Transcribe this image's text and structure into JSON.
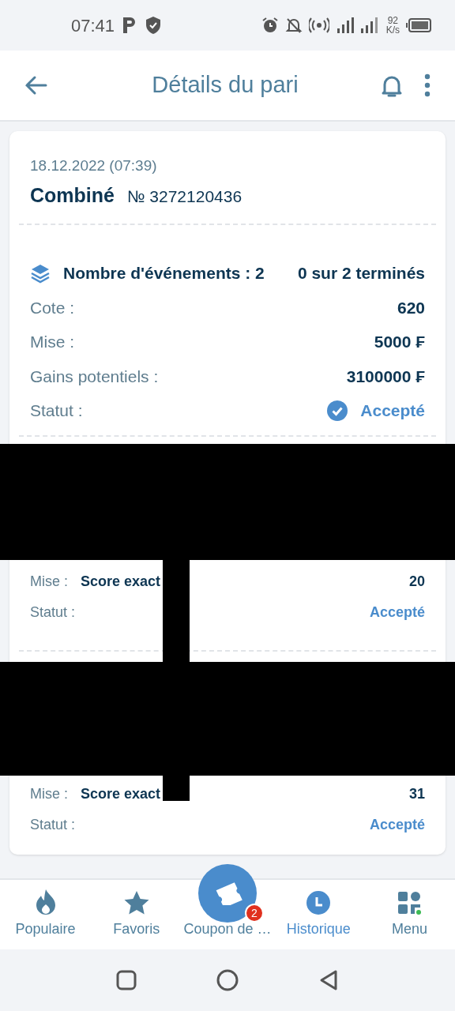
{
  "status_bar": {
    "time": "07:41",
    "net_speed": "92",
    "net_unit": "K/s"
  },
  "header": {
    "title": "Détails du pari"
  },
  "bet": {
    "date": "18.12.2022 (07:39)",
    "type": "Combiné",
    "number": "№ 3272120436"
  },
  "summary": {
    "events": "Nombre d'événements : 2",
    "finished": "0 sur 2 terminés",
    "rows": [
      {
        "kind": "plain",
        "label": "Cote :",
        "value": "620"
      },
      {
        "kind": "plain",
        "label": "Mise :",
        "value": "5000 ₣"
      },
      {
        "kind": "plain",
        "label": "Gains potentiels :",
        "value": "3100000 ₣"
      },
      {
        "kind": "status",
        "label": "Statut :",
        "value": "Accepté"
      }
    ]
  },
  "events": [
    {
      "label": "Mise :",
      "market": "Score exact",
      "odds": "20",
      "status_label": "Statut :",
      "status": "Accepté"
    },
    {
      "label": "Mise :",
      "market": "Score exact",
      "odds": "31",
      "status_label": "Statut :",
      "status": "Accepté"
    }
  ],
  "bottom_nav": [
    {
      "label": "Populaire",
      "kind": "flame",
      "selected": false
    },
    {
      "label": "Favoris",
      "kind": "star",
      "selected": false
    },
    {
      "label": "Coupon de …",
      "kind": "ticket",
      "selected": false,
      "badge": "2"
    },
    {
      "label": "Historique",
      "kind": "clock",
      "selected": true
    },
    {
      "label": "Menu",
      "kind": "grid",
      "selected": false
    }
  ]
}
